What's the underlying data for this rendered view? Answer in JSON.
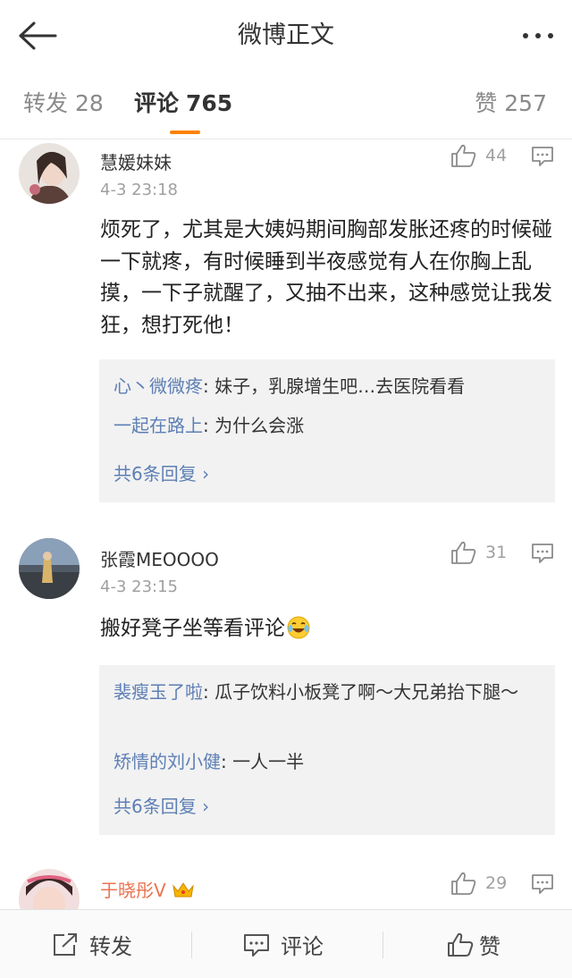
{
  "header": {
    "title": "微博正文"
  },
  "tabs": {
    "repost_label": "转发",
    "repost_count": "28",
    "comment_label": "评论",
    "comment_count": "765",
    "like_label": "赞",
    "like_count": "257"
  },
  "comments": [
    {
      "user": "慧媛妹妹",
      "time": "4-3 23:18",
      "likes": "44",
      "text": "烦死了，尤其是大姨妈期间胸部发胀还疼的时候碰一下就疼，有时候睡到半夜感觉有人在你胸上乱摸，一下子就醒了，又抽不出来，这种感觉让我发狂，想打死他！",
      "replies": [
        {
          "user": "心丶微微疼",
          "text": ": 妹子，乳腺增生吧…去医院看看"
        },
        {
          "user": "一起在路上",
          "text": ": 为什么会涨"
        }
      ],
      "more": "共6条回复 ›"
    },
    {
      "user": "张霞MEOOOO",
      "time": "4-3 23:15",
      "likes": "31",
      "text": "搬好凳子坐等看评论",
      "emoji": "laugh-cry-emoji",
      "replies": [
        {
          "user": "裴瘦玉了啦",
          "text": ": 瓜子饮料小板凳了啊～大兄弟抬下腿～"
        },
        {
          "user": "矫情的刘小健",
          "text": ": 一人一半"
        }
      ],
      "more": "共6条回复 ›"
    },
    {
      "user": "于晓彤V",
      "likes": "29",
      "badge": "crown-icon"
    }
  ],
  "toolbar": {
    "repost_label": "转发",
    "comment_label": "评论",
    "like_label": "赞"
  },
  "colors": {
    "accent": "#ff8200",
    "link": "#5d7fb5",
    "vip_name": "#eb7350",
    "sub_bg": "#f2f2f2"
  }
}
